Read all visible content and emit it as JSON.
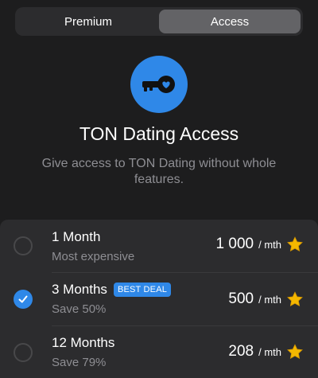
{
  "tabs": [
    {
      "label": "Premium",
      "active": false
    },
    {
      "label": "Access",
      "active": true
    }
  ],
  "header": {
    "icon": "key-icon",
    "title": "TON Dating Access",
    "subtitle": "Give access to TON Dating without whole features."
  },
  "colors": {
    "accent": "#2f88e8",
    "background": "#1d1d1e",
    "card": "#2c2c2e",
    "muted": "#8e8e93",
    "star": "#f5b800"
  },
  "plans": [
    {
      "name": "1 Month",
      "badge": "",
      "note": "Most expensive",
      "price": "1 000",
      "unit": "/ mth",
      "selected": false,
      "icon": "star-icon"
    },
    {
      "name": "3 Months",
      "badge": "BEST DEAL",
      "note": "Save 50%",
      "price": "500",
      "unit": "/ mth",
      "selected": true,
      "icon": "star-icon"
    },
    {
      "name": "12 Months",
      "badge": "",
      "note": "Save 79%",
      "price": "208",
      "unit": "/ mth",
      "selected": false,
      "icon": "star-icon"
    }
  ]
}
